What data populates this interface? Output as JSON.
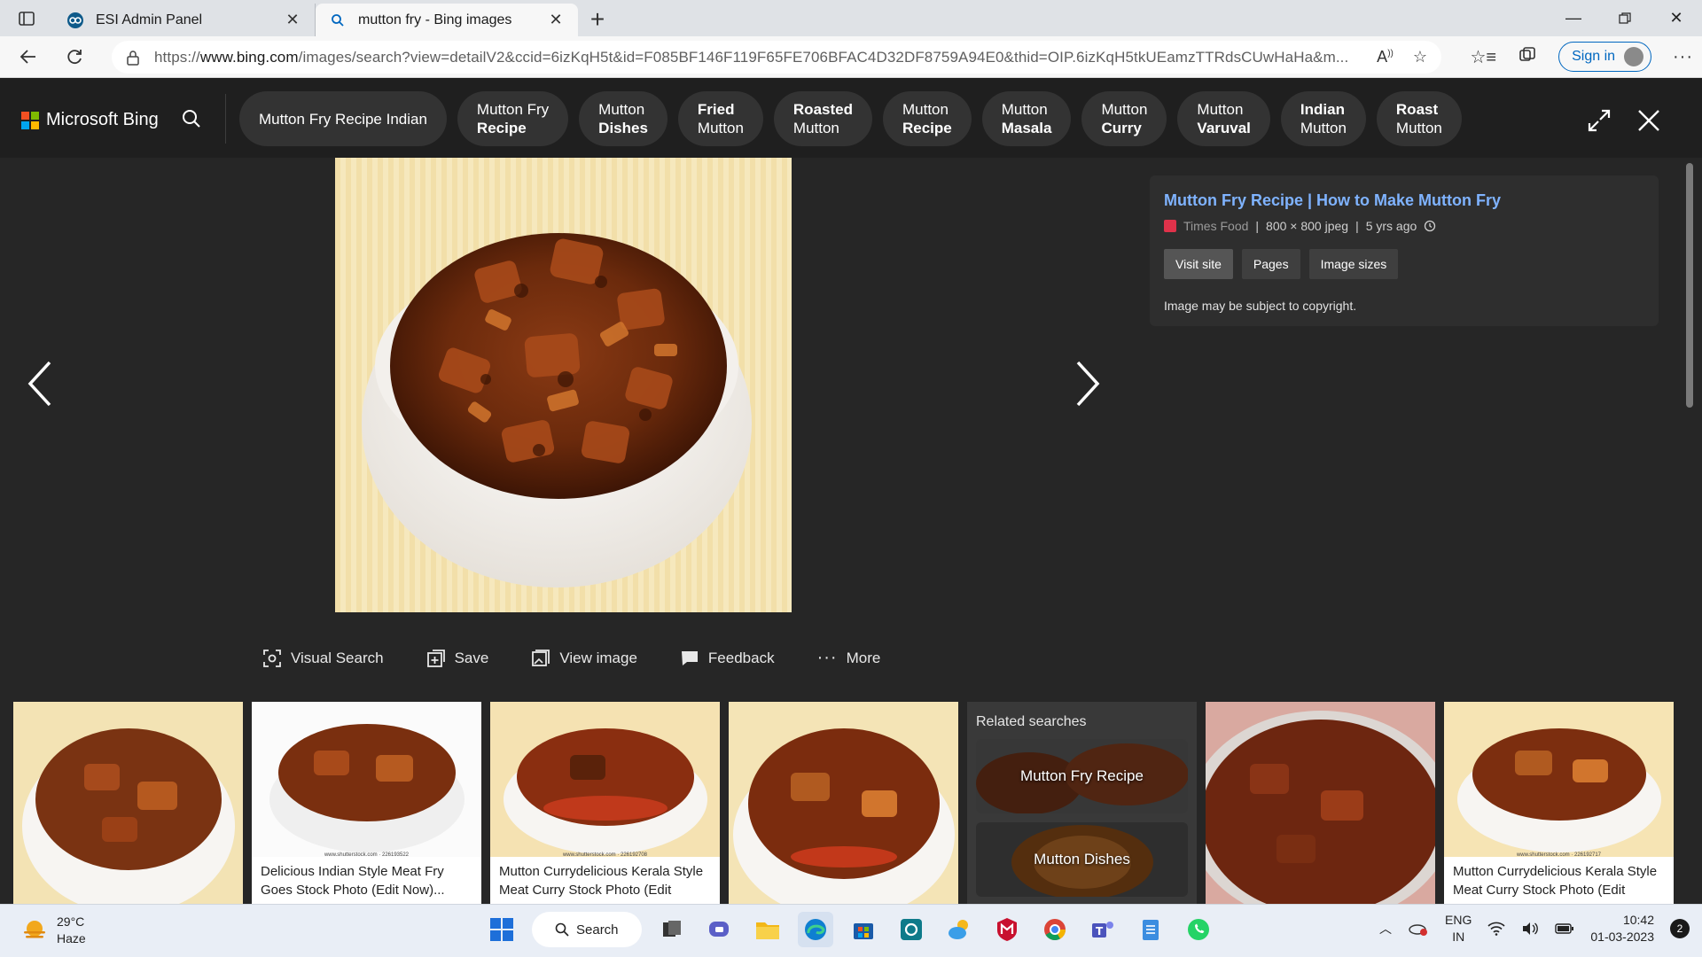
{
  "browser": {
    "tabs": [
      {
        "title": "ESI Admin Panel",
        "active": false
      },
      {
        "title": "mutton fry - Bing images",
        "active": true
      }
    ],
    "url_prefix": "https://",
    "url_host": "www.bing.com",
    "url_rest": "/images/search?view=detailV2&ccid=6izKqH5t&id=F085BF146F119F65FE706BFAC4D32DF8759A94E0&thid=OIP.6izKqH5tkUEamzTTRdsCUwHaHa&m...",
    "sign_in": "Sign in"
  },
  "bing": {
    "logo_text": "Microsoft Bing",
    "chips": [
      {
        "line1": "Mutton Fry Recipe Indian",
        "line2": "",
        "bold": ""
      },
      {
        "line1": "Mutton Fry",
        "line2": "Recipe",
        "bold": "2"
      },
      {
        "line1": "Mutton",
        "line2": "Dishes",
        "bold": "2"
      },
      {
        "line1": "Fried",
        "line2": "Mutton",
        "bold": "1"
      },
      {
        "line1": "Roasted",
        "line2": "Mutton",
        "bold": "1"
      },
      {
        "line1": "Mutton",
        "line2": "Recipe",
        "bold": "2"
      },
      {
        "line1": "Mutton",
        "line2": "Masala",
        "bold": "2"
      },
      {
        "line1": "Mutton",
        "line2": "Curry",
        "bold": "2"
      },
      {
        "line1": "Mutton",
        "line2": "Varuval",
        "bold": "2"
      },
      {
        "line1": "Indian",
        "line2": "Mutton",
        "bold": "1"
      },
      {
        "line1": "Roast",
        "line2": "Mutton",
        "bold": "1"
      }
    ]
  },
  "detail": {
    "title": "Mutton Fry Recipe | How to Make Mutton Fry",
    "source": "Times Food",
    "dimensions": "800 × 800 jpeg",
    "age": "5 yrs ago",
    "buttons": [
      "Visit site",
      "Pages",
      "Image sizes"
    ],
    "copyright": "Image may be subject to copyright."
  },
  "actions": [
    "Visual Search",
    "Save",
    "View image",
    "Feedback",
    "More"
  ],
  "filmstrip": {
    "thumbs": [
      {
        "caption_1": "",
        "caption_2": "",
        "stock": ""
      },
      {
        "caption_1": "Delicious Indian Style Meat Fry",
        "caption_2": "Goes Stock Photo (Edit Now)...",
        "stock": "www.shutterstock.com · 226193522"
      },
      {
        "caption_1": "Mutton Currydelicious Kerala Style",
        "caption_2": "Meat Curry Stock Photo (Edit Now...",
        "stock": "www.shutterstock.com · 226192708"
      },
      {
        "caption_1": "",
        "caption_2": "",
        "stock": ""
      },
      {
        "caption_1": "",
        "caption_2": "",
        "stock": ""
      },
      {
        "caption_1": "Mutton Currydelicious Kerala Style",
        "caption_2": "Meat Curry Stock Photo (Edit Now...",
        "stock": "www.shutterstock.com · 226192717"
      }
    ],
    "related_title": "Related searches",
    "related_items": [
      "Mutton Fry Recipe",
      "Mutton Dishes"
    ]
  },
  "taskbar": {
    "temperature": "29°C",
    "weather": "Haze",
    "search": "Search",
    "lang_1": "ENG",
    "lang_2": "IN",
    "time": "10:42",
    "date": "01-03-2023",
    "notifications": "2"
  },
  "colors": {
    "accent_link": "#7fb3ff",
    "bing_bg": "#1f1f1f",
    "chip_bg": "#333333",
    "edge_blue": "#0067c0"
  }
}
